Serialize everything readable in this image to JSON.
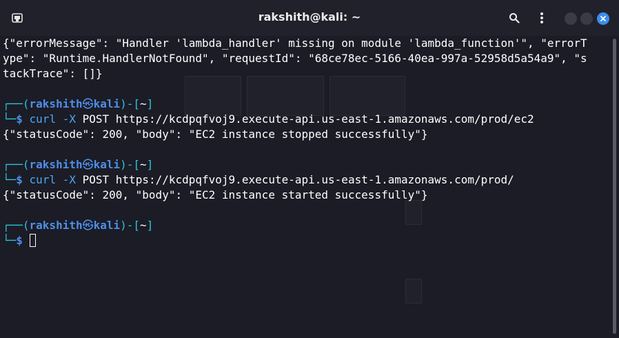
{
  "window": {
    "title": "rakshith@kali: ~"
  },
  "icons": {
    "terminal": "terminal-icon",
    "search": "search-icon",
    "menu": "kebab-menu-icon",
    "minimize": "minimize-icon",
    "maximize": "maximize-icon",
    "close": "close-icon"
  },
  "colors": {
    "prompt_frame": "#2ec4d6",
    "user": "#4f8fe8",
    "close": "#3b8eea"
  },
  "output": {
    "error_line1": "{\"errorMessage\": \"Handler 'lambda_handler' missing on module 'lambda_function'\", \"errorT",
    "error_line2": "ype\": \"Runtime.HandlerNotFound\", \"requestId\": \"68ce78ec-5166-40ea-997a-52958d5a54a9\", \"s",
    "error_line3": "tackTrace\": []}"
  },
  "prompt": {
    "frame_open": "┌──(",
    "user": "rakshith",
    "skull": "㉿",
    "host": "kali",
    "frame_mid": ")-[",
    "dir": "~",
    "frame_close": "]",
    "line2_frame": "└─",
    "dollar": "$"
  },
  "commands": [
    {
      "cmd": "curl",
      "opt": "-X",
      "args": "POST https://kcdpqfvoj9.execute-api.us-east-1.amazonaws.com/prod/ec2",
      "result": "{\"statusCode\": 200, \"body\": \"EC2 instance stopped successfully\"}"
    },
    {
      "cmd": "curl",
      "opt": "-X",
      "args": "POST https://kcdpqfvoj9.execute-api.us-east-1.amazonaws.com/prod/",
      "result": "{\"statusCode\": 200, \"body\": \"EC2 instance started successfully\"}"
    }
  ]
}
